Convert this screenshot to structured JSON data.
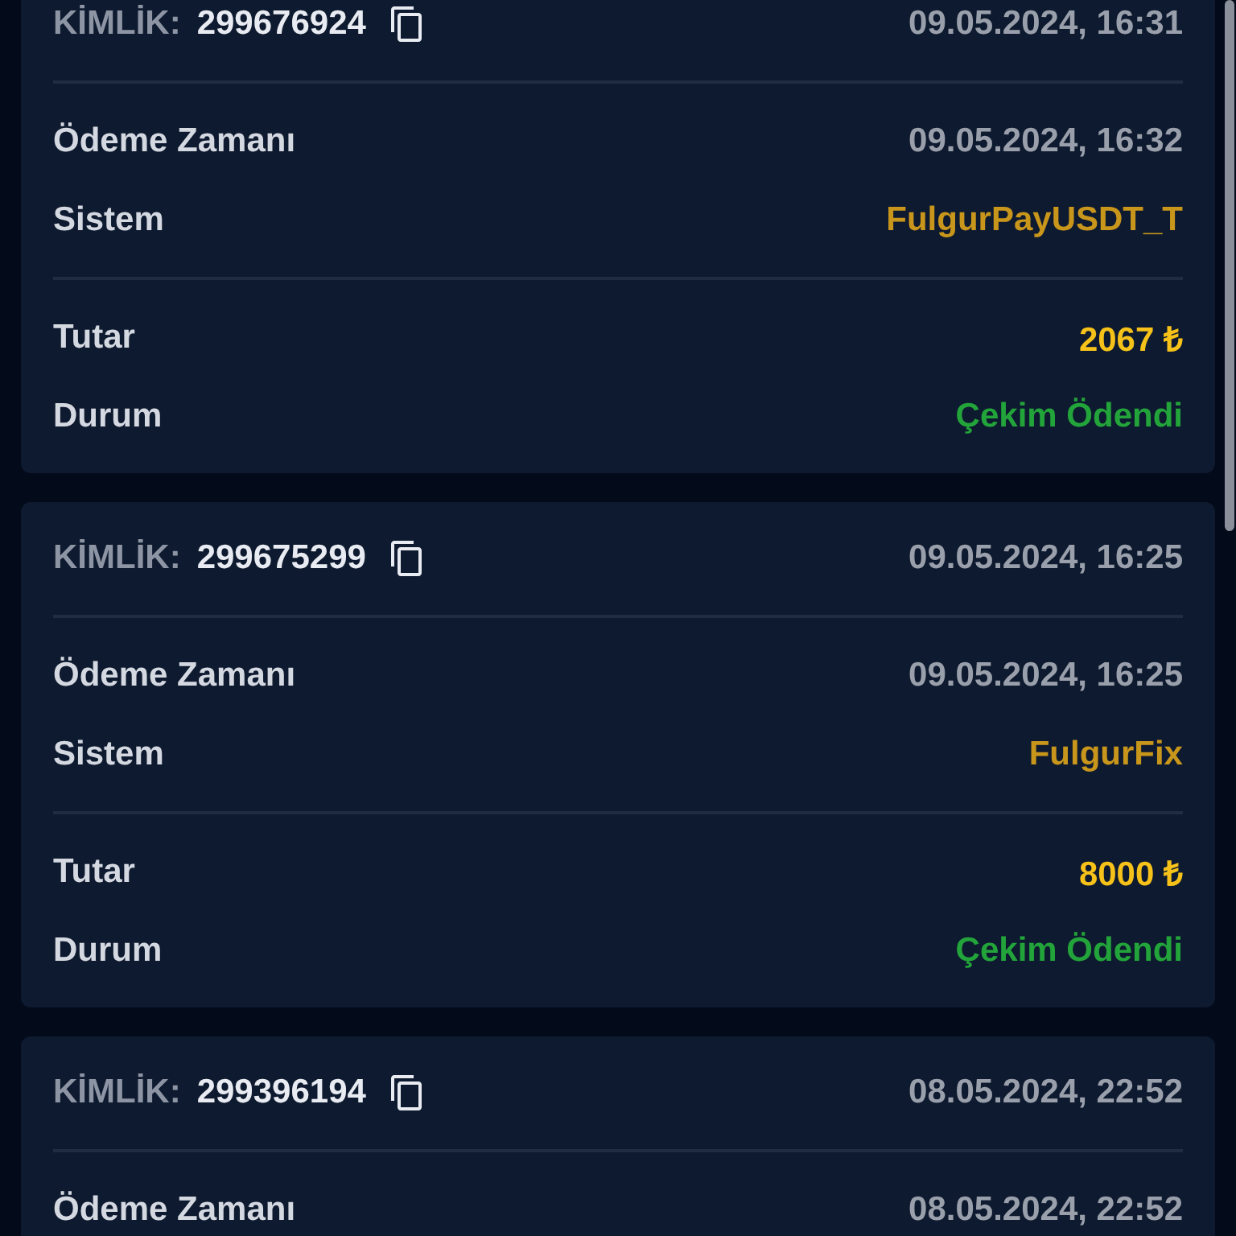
{
  "transactions": [
    {
      "id_label": "KİMLİK:",
      "id": "299676924",
      "date": "09.05.2024, 16:31",
      "rows": [
        {
          "kind": "time",
          "label": "Ödeme Zamanı",
          "value": "09.05.2024, 16:32"
        },
        {
          "kind": "system",
          "label": "Sistem",
          "value": "FulgurPayUSDT_T"
        },
        {
          "kind": "amount",
          "label": "Tutar",
          "value": "2067 ₺"
        },
        {
          "kind": "status",
          "label": "Durum",
          "value": "Çekim Ödendi"
        }
      ]
    },
    {
      "id_label": "KİMLİK:",
      "id": "299675299",
      "date": "09.05.2024, 16:25",
      "rows": [
        {
          "kind": "time",
          "label": "Ödeme Zamanı",
          "value": "09.05.2024, 16:25"
        },
        {
          "kind": "system",
          "label": "Sistem",
          "value": "FulgurFix"
        },
        {
          "kind": "amount",
          "label": "Tutar",
          "value": "8000 ₺"
        },
        {
          "kind": "status",
          "label": "Durum",
          "value": "Çekim Ödendi"
        }
      ]
    },
    {
      "id_label": "KİMLİK:",
      "id": "299396194",
      "date": "08.05.2024, 22:52",
      "rows": [
        {
          "kind": "time",
          "label": "Ödeme Zamanı",
          "value": "08.05.2024, 22:52"
        }
      ]
    }
  ]
}
